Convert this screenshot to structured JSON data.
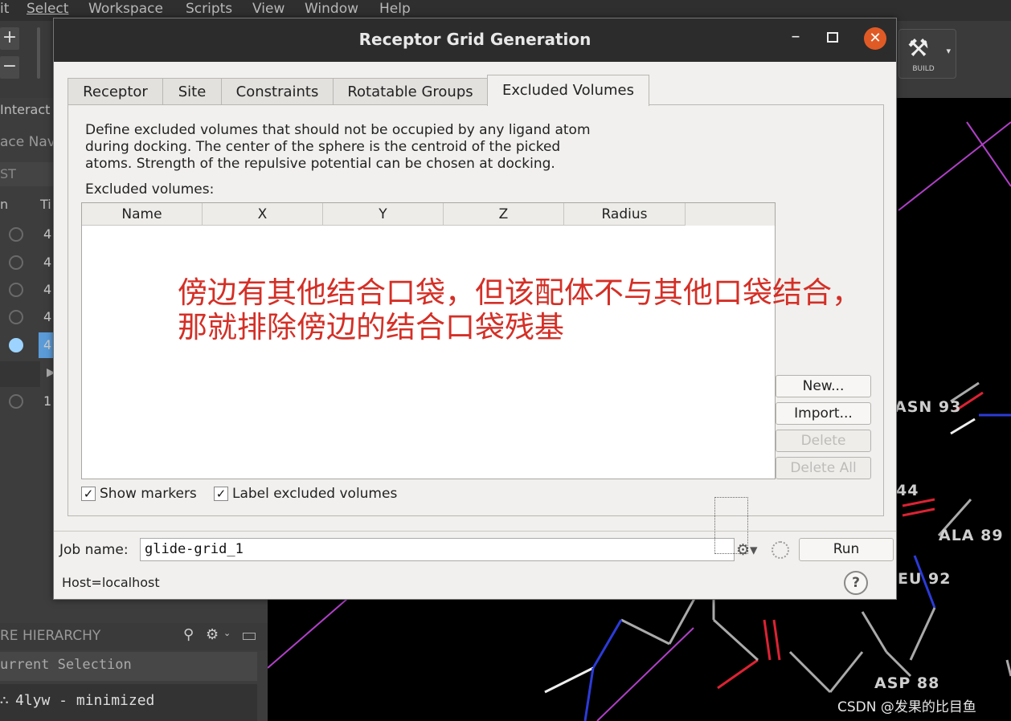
{
  "menubar": {
    "items": [
      "it",
      "Select",
      "Workspace",
      "Scripts",
      "View",
      "Window",
      "Help"
    ]
  },
  "toolbar": {
    "plus_label": "+",
    "minus_label": "−",
    "build_label": "BUILD"
  },
  "left_panel": {
    "interact_label": "Interact",
    "nav_label": "ace Nav",
    "st_label": "ST",
    "col_n": "n",
    "col_ti": "Ti",
    "rows": [
      "4",
      "4",
      "4",
      "4",
      "4",
      "1"
    ],
    "hierarchy_label": "RE HIERARCHY",
    "current_selection": "urrent Selection",
    "entry": "4lyw - minimized"
  },
  "viewer": {
    "residues": [
      "ASN 93",
      "44",
      "ALA 89",
      "EU 92",
      "ASP 88"
    ]
  },
  "dialog": {
    "title": "Receptor Grid Generation",
    "minimize_glyph": "–",
    "close_glyph": "✕",
    "tabs": [
      {
        "label": "Receptor"
      },
      {
        "label": "Site"
      },
      {
        "label": "Constraints"
      },
      {
        "label": "Rotatable Groups"
      },
      {
        "label": "Excluded Volumes"
      }
    ],
    "description": [
      "Define excluded volumes that should not be occupied by any ligand atom",
      "during docking.  The center of the sphere is the centroid of the picked",
      "atoms.  Strength of the repulsive potential can be chosen at docking."
    ],
    "excluded_volumes_label": "Excluded volumes:",
    "table_columns": [
      "Name",
      "X",
      "Y",
      "Z",
      "Radius"
    ],
    "buttons": {
      "new": "New...",
      "import": "Import...",
      "delete": "Delete",
      "delete_all": "Delete All"
    },
    "show_markers": {
      "label": "Show markers",
      "checked": true
    },
    "label_excluded": {
      "label": "Label excluded volumes",
      "checked": true
    },
    "check_glyph": "✓",
    "job_name_label": "Job name:",
    "job_name_value": "glide-grid_1",
    "run_label": "Run",
    "host_label": "Host=localhost",
    "help_glyph": "?"
  },
  "annotation": {
    "line1": "傍边有其他结合口袋，但该配体不与其他口袋结合，",
    "line2": "那就排除傍边的结合口袋残基",
    "color": "#d42f26"
  },
  "watermark": "CSDN @发果的比目鱼"
}
